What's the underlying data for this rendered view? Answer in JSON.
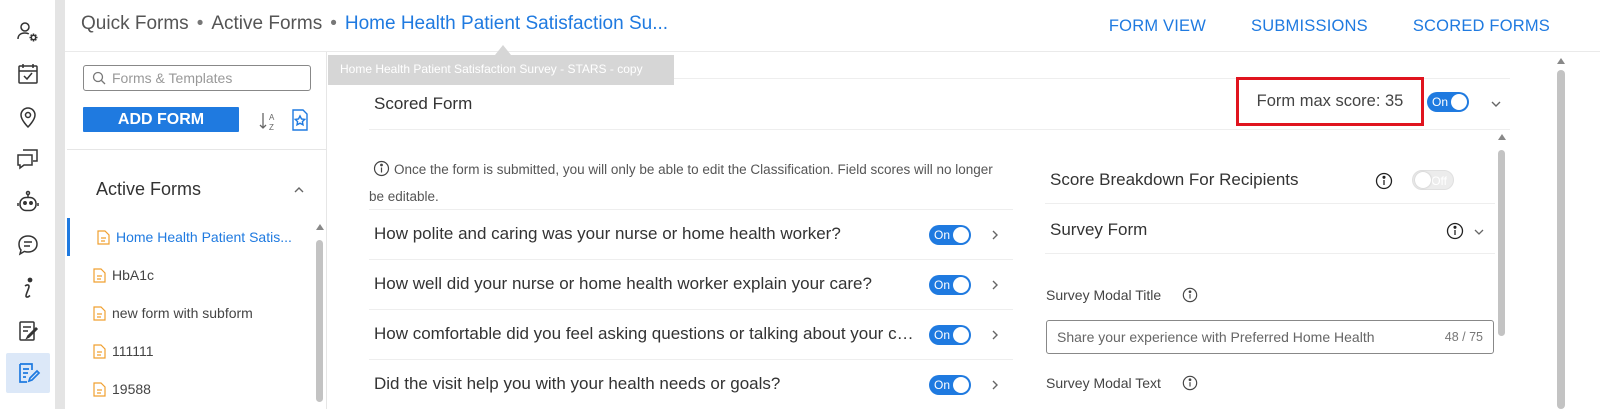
{
  "rail": {
    "items": [
      {
        "name": "user-settings-icon"
      },
      {
        "name": "calendar-check-icon"
      },
      {
        "name": "location-pin-icon"
      },
      {
        "name": "chat-bubbles-icon"
      },
      {
        "name": "robot-icon"
      },
      {
        "name": "message-icon"
      },
      {
        "name": "info-icon"
      },
      {
        "name": "clipboard-edit-icon"
      },
      {
        "name": "forms-edit-icon",
        "active": true
      }
    ]
  },
  "header": {
    "breadcrumb": [
      "Quick Forms",
      "Active Forms",
      "Home Health Patient Satisfaction Su..."
    ],
    "separator": "•",
    "tooltip": "Home Health Patient Satisfaction Survey - STARS - copy",
    "nav": [
      "FORM VIEW",
      "SUBMISSIONS",
      "SCORED FORMS"
    ]
  },
  "forms_panel": {
    "search_placeholder": "Forms & Templates",
    "add_form_label": "ADD FORM",
    "section_title": "Active Forms",
    "items": [
      {
        "label": "Home Health Patient Satis...",
        "active": true
      },
      {
        "label": "HbA1c"
      },
      {
        "label": "new form with subform"
      },
      {
        "label": "111111"
      },
      {
        "label": "19588"
      }
    ]
  },
  "scored_form": {
    "title": "Scored Form",
    "max_score_label": "Form max score: 35",
    "toggle_label": "On",
    "info_note": "Once the form is submitted, you will only be able to edit the Classification. Field scores will no longer be editable.",
    "questions": [
      {
        "text": "How polite and caring was your nurse or home health worker?",
        "toggle": "On"
      },
      {
        "text": "How well did your nurse or home health worker explain your care?",
        "toggle": "On"
      },
      {
        "text": "How comfortable did you feel asking questions or talking about your concerns?",
        "toggle": "On"
      },
      {
        "text": "Did the visit help you with your health needs or goals?",
        "toggle": "On"
      }
    ]
  },
  "right_panel": {
    "score_breakdown_label": "Score Breakdown For Recipients",
    "score_breakdown_toggle": "Off",
    "survey_form_label": "Survey Form",
    "survey_modal_title_label": "Survey Modal Title",
    "survey_modal_title_value": "Share your experience with Preferred Home Health",
    "survey_modal_title_count": "48 / 75",
    "survey_modal_text_label": "Survey Modal Text"
  },
  "colors": {
    "accent": "#1f7ae0",
    "highlight_border": "#e0141e"
  }
}
